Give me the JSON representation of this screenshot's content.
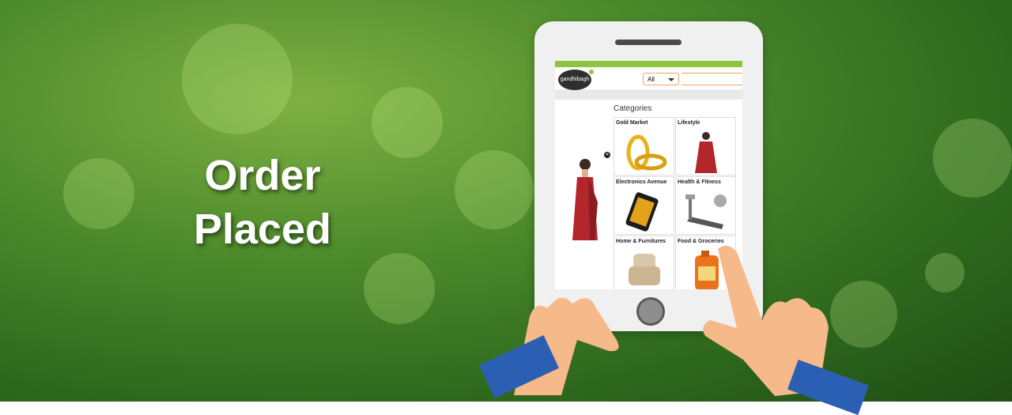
{
  "headline": {
    "line1": "Order",
    "line2": "Placed"
  },
  "app": {
    "logo_text": "gandhibagh",
    "search": {
      "category_selected": "All",
      "placeholder": ""
    },
    "categories_title": "Categories",
    "categories": [
      {
        "label": "Gold Market",
        "icon": "gold-bangles-icon"
      },
      {
        "label": "Lifestyle",
        "icon": "saree-icon"
      },
      {
        "label": "Electronics Avenue",
        "icon": "smartphone-icon"
      },
      {
        "label": "Health & Fitness",
        "icon": "treadmill-icon"
      },
      {
        "label": "Home & Furnitures",
        "icon": "armchair-icon"
      },
      {
        "label": "Food & Groceries",
        "icon": "oil-bottle-icon"
      }
    ]
  },
  "colors": {
    "accent": "#8cc63f",
    "search_border": "#f5a25d",
    "saree": "#b3262c",
    "gold": "#e8b21a",
    "sleeve": "#2b5fb3",
    "hand": "#f6b98a"
  }
}
